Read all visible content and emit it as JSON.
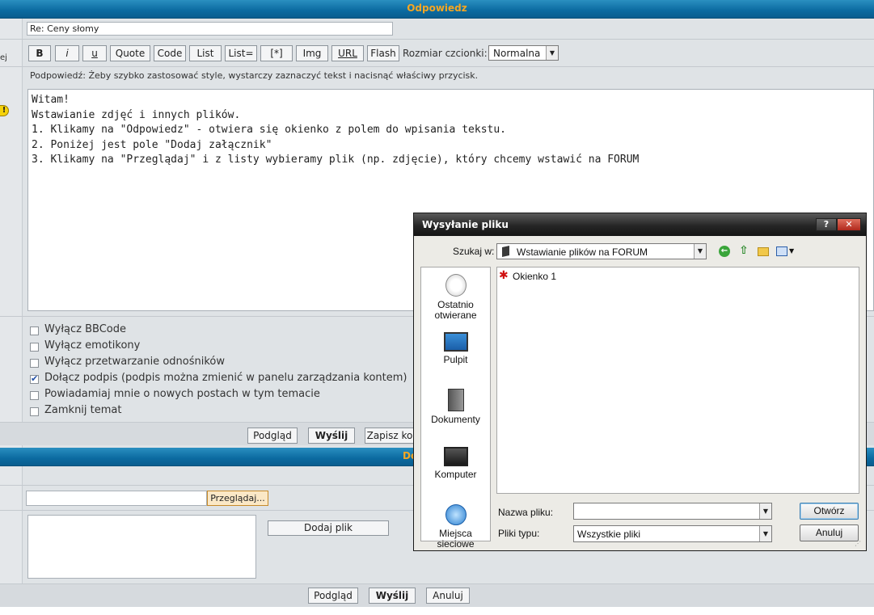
{
  "header": {
    "title": "Odpowiedz",
    "left_fragment": "ej"
  },
  "subject": {
    "value": "Re: Ceny słomy"
  },
  "toolbar": {
    "buttons": [
      "B",
      "i",
      "u",
      "Quote",
      "Code",
      "List",
      "List=",
      "[*]",
      "Img",
      "URL",
      "Flash"
    ],
    "font_size_label": "Rozmiar czcionki:",
    "font_size_value": "Normalna"
  },
  "hint": "Podpowiedź: Żeby szybko zastosować style, wystarczy zaznaczyć tekst i nacisnąć właściwy przycisk.",
  "message": {
    "lines": [
      "Witam!",
      "Wstawianie zdjęć i innych plików.",
      "1. Klikamy na \"Odpowiedz\" - otwiera się okienko z polem do wpisania tekstu.",
      "2. Poniżej jest pole \"Dodaj załącznik\"",
      "3. Klikamy na \"Przeglądaj\" i z listy wybieramy plik (np. zdjęcie), który chcemy wstawić na FORUM"
    ]
  },
  "options": [
    {
      "label": "Wyłącz BBCode",
      "checked": false
    },
    {
      "label": "Wyłącz emotikony",
      "checked": false
    },
    {
      "label": "Wyłącz przetwarzanie odnośników",
      "checked": false
    },
    {
      "label": "Dołącz podpis (podpis można zmienić w panelu zarządzania kontem)",
      "checked": true
    },
    {
      "label": "Powiadamiaj mnie o nowych postach w tym temacie",
      "checked": false
    },
    {
      "label": "Zamknij temat",
      "checked": false
    }
  ],
  "actions": {
    "preview": "Podgląd",
    "send": "Wyślij",
    "save": "Zapisz ko"
  },
  "attach": {
    "title": "Dodaj załącz",
    "browse": "Przeglądaj...",
    "add_file": "Dodaj plik",
    "preview": "Podgląd",
    "send": "Wyślij",
    "cancel": "Anuluj"
  },
  "dialog": {
    "title": "Wysyłanie pliku",
    "help_btn": "?",
    "close_btn": "✕",
    "look_in_label": "Szukaj w:",
    "look_in_value": "Wstawianie plików na FORUM",
    "places": [
      {
        "label": "Ostatnio otwierane",
        "icon": "recent-icon"
      },
      {
        "label": "Pulpit",
        "icon": "desktop-icon"
      },
      {
        "label": "Dokumenty",
        "icon": "documents-icon"
      },
      {
        "label": "Komputer",
        "icon": "computer-icon"
      },
      {
        "label": "Miejsca sieciowe",
        "icon": "network-icon"
      }
    ],
    "files": [
      {
        "name": "Okienko 1",
        "icon": "paint-splash-icon"
      }
    ],
    "filename_label": "Nazwa pliku:",
    "filename_value": "",
    "filetype_label": "Pliki typu:",
    "filetype_value": "Wszystkie pliki",
    "open_btn": "Otwórz",
    "cancel_btn": "Anuluj"
  }
}
